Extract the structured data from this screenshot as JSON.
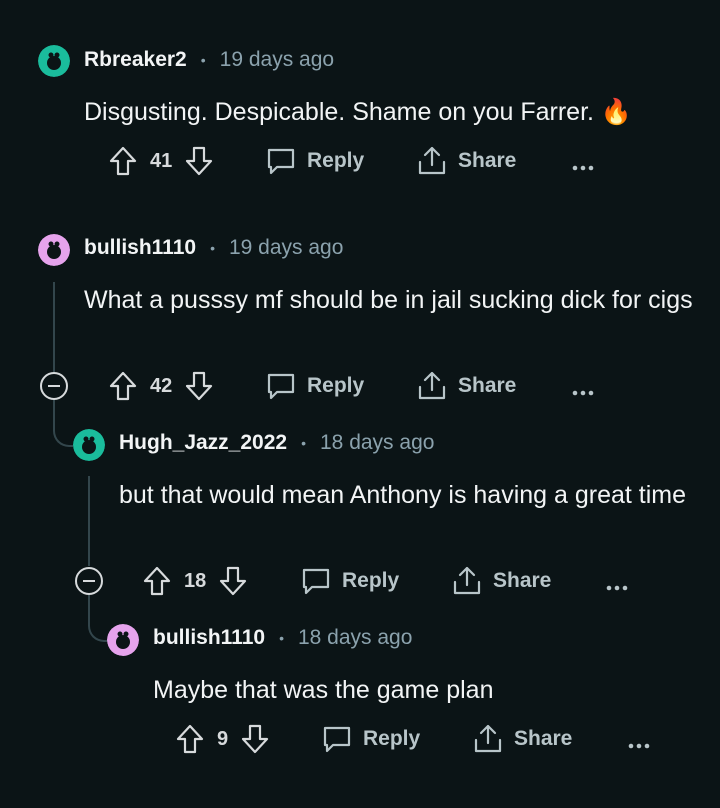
{
  "comments": [
    {
      "username": "Rbreaker2",
      "time": "19 days ago",
      "text": "Disgusting. Despicable. Shame on you Farrer. 🔥",
      "votes": "41",
      "reply_label": "Reply",
      "share_label": "Share",
      "avatar_color": "#1abc9c"
    },
    {
      "username": "bullish1110",
      "time": "19 days ago",
      "text": "What a pusssy mf should be in jail sucking dick for cigs",
      "votes": "42",
      "reply_label": "Reply",
      "share_label": "Share",
      "avatar_color": "#e6a3ec"
    },
    {
      "username": "Hugh_Jazz_2022",
      "time": "18 days ago",
      "text": "but that would mean Anthony is having a great time",
      "votes": "18",
      "reply_label": "Reply",
      "share_label": "Share",
      "avatar_color": "#1abc9c"
    },
    {
      "username": "bullish1110",
      "time": "18 days ago",
      "text": "Maybe that was the game plan",
      "votes": "9",
      "reply_label": "Reply",
      "share_label": "Share",
      "avatar_color": "#e6a3ec"
    }
  ],
  "separator": "•",
  "icons": [
    "upvote-icon",
    "downvote-icon",
    "reply-icon",
    "share-icon",
    "more-icon",
    "collapse-icon"
  ]
}
